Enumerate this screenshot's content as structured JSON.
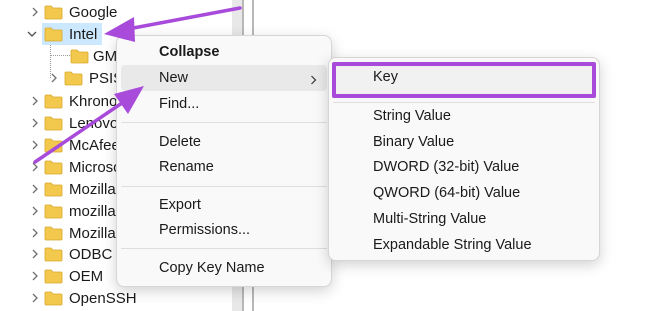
{
  "tree": {
    "items": [
      {
        "label": "Google",
        "expanded": false,
        "indent": 0
      },
      {
        "label": "Intel",
        "expanded": true,
        "indent": 0,
        "selected": true
      },
      {
        "label": "GMM",
        "expanded": false,
        "indent": 1,
        "leaf": true
      },
      {
        "label": "PSIS",
        "expanded": false,
        "indent": 1
      },
      {
        "label": "Khronos",
        "expanded": false,
        "indent": 0
      },
      {
        "label": "Lenovo",
        "expanded": false,
        "indent": 0
      },
      {
        "label": "McAfee",
        "expanded": false,
        "indent": 0
      },
      {
        "label": "Microsoft",
        "expanded": false,
        "indent": 0
      },
      {
        "label": "Mozilla",
        "expanded": false,
        "indent": 0
      },
      {
        "label": "mozilla.org",
        "expanded": false,
        "indent": 0
      },
      {
        "label": "MozillaPlugins",
        "expanded": false,
        "indent": 0
      },
      {
        "label": "ODBC",
        "expanded": false,
        "indent": 0
      },
      {
        "label": "OEM",
        "expanded": false,
        "indent": 0
      },
      {
        "label": "OpenSSH",
        "expanded": false,
        "indent": 0
      }
    ]
  },
  "context_menu": {
    "items": [
      {
        "label": "Collapse",
        "bold": true
      },
      {
        "label": "New",
        "submenu": true,
        "hover": true
      },
      {
        "label": "Find..."
      },
      {
        "separator": true
      },
      {
        "label": "Delete"
      },
      {
        "label": "Rename"
      },
      {
        "separator": true
      },
      {
        "label": "Export"
      },
      {
        "label": "Permissions..."
      },
      {
        "separator": true
      },
      {
        "label": "Copy Key Name"
      }
    ]
  },
  "submenu": {
    "items": [
      {
        "label": "Key",
        "highlighted": true
      },
      {
        "separator": true
      },
      {
        "label": "String Value"
      },
      {
        "label": "Binary Value"
      },
      {
        "label": "DWORD (32-bit) Value"
      },
      {
        "label": "QWORD (64-bit) Value"
      },
      {
        "label": "Multi-String Value"
      },
      {
        "label": "Expandable String Value"
      }
    ]
  },
  "colors": {
    "folder": "#f2c94c",
    "selection": "#cce8ff",
    "annotation": "#a84bdb"
  },
  "icons": {
    "folder": "folder-icon",
    "expand": "chevron-right-icon",
    "collapse": "chevron-down-icon",
    "submenu": "chevron-right-icon"
  }
}
